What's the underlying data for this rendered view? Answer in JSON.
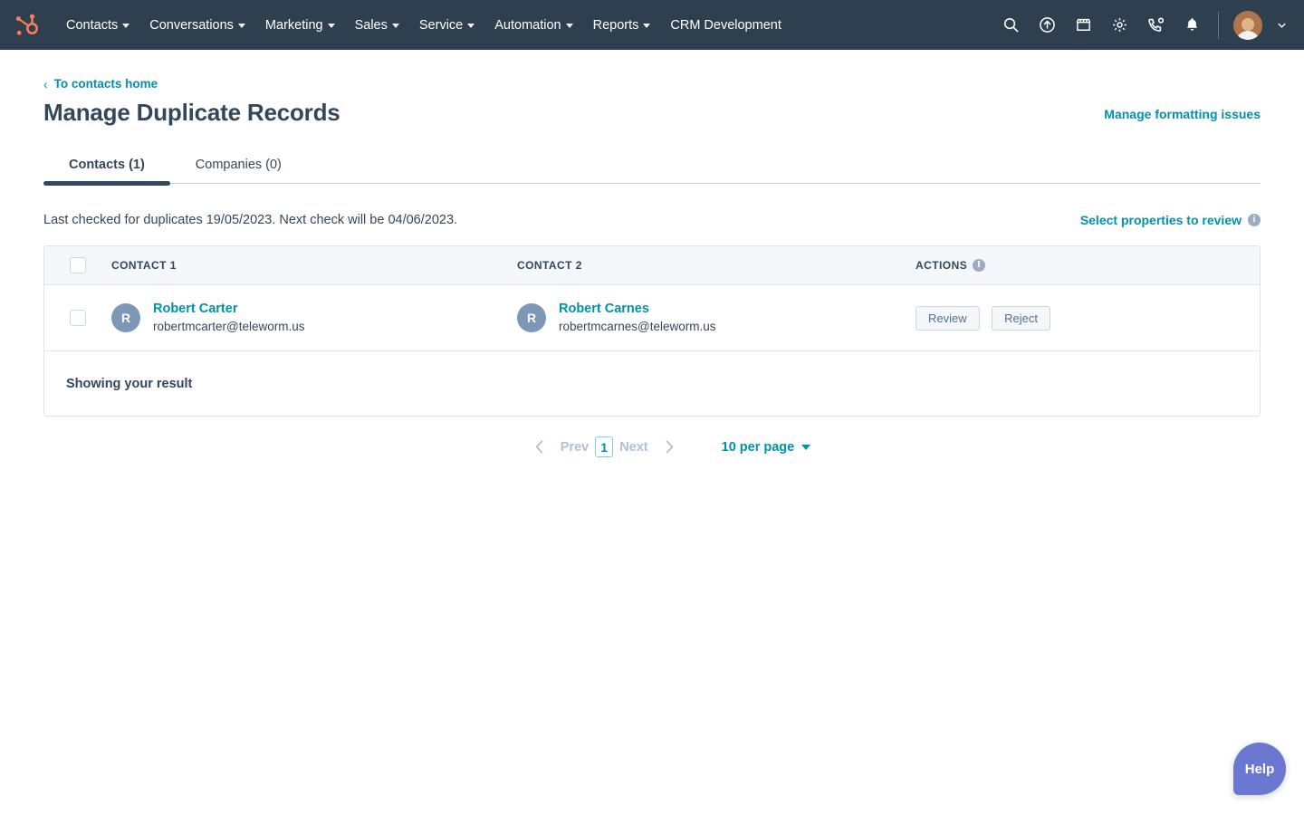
{
  "topnav": {
    "logo_icon": "hubspot-sprocket-logo",
    "brand_color": "#ff7a59",
    "background_color": "#2e3f50",
    "items": [
      {
        "label": "Contacts",
        "has_caret": true
      },
      {
        "label": "Conversations",
        "has_caret": true
      },
      {
        "label": "Marketing",
        "has_caret": true
      },
      {
        "label": "Sales",
        "has_caret": true
      },
      {
        "label": "Service",
        "has_caret": true
      },
      {
        "label": "Automation",
        "has_caret": true
      },
      {
        "label": "Reports",
        "has_caret": true
      },
      {
        "label": "CRM Development",
        "has_caret": false
      }
    ],
    "icons": [
      {
        "name": "search-icon"
      },
      {
        "name": "upgrade-arrow-icon"
      },
      {
        "name": "marketplace-store-icon"
      },
      {
        "name": "settings-gear-icon"
      },
      {
        "name": "phone-call-icon"
      },
      {
        "name": "notifications-bell-icon"
      }
    ],
    "avatar_name": "user-avatar",
    "avatar_caret_icon": "chevron-down-icon"
  },
  "breadcrumb": {
    "icon": "chevron-left-icon",
    "label": "To contacts home"
  },
  "header": {
    "title": "Manage Duplicate Records",
    "action_link": "Manage formatting issues"
  },
  "tabs": [
    {
      "label": "Contacts (1)",
      "active": true
    },
    {
      "label": "Companies (0)",
      "active": false
    }
  ],
  "subheader": {
    "last_checked": "Last checked for duplicates 19/05/2023. Next check will be 04/06/2023.",
    "select_properties_link": "Select properties to review",
    "info_icon_char": "i"
  },
  "table": {
    "columns": {
      "contact1": "CONTACT 1",
      "contact2": "CONTACT 2",
      "actions": "ACTIONS"
    },
    "actions_info_char": "i",
    "header_bg": "#f5f8fa",
    "rows": [
      {
        "contact1": {
          "initial": "R",
          "name": "Robert Carter",
          "email": "robertmcarter@teleworm.us"
        },
        "contact2": {
          "initial": "R",
          "name": "Robert Carnes",
          "email": "robertmcarnes@teleworm.us"
        },
        "actions": {
          "review": "Review",
          "reject": "Reject"
        }
      }
    ],
    "footer_label": "Showing your result"
  },
  "pagination": {
    "prev_arrow_icon": "chevron-left-icon",
    "prev_label": "Prev",
    "current_page": "1",
    "next_label": "Next",
    "next_arrow_icon": "chevron-right-icon",
    "per_page_label": "10 per page"
  },
  "help": {
    "label": "Help",
    "color": "#6a78d1"
  },
  "colors": {
    "link_teal": "#0091ae",
    "text_dark": "#33475b",
    "border": "#dfe3eb"
  }
}
